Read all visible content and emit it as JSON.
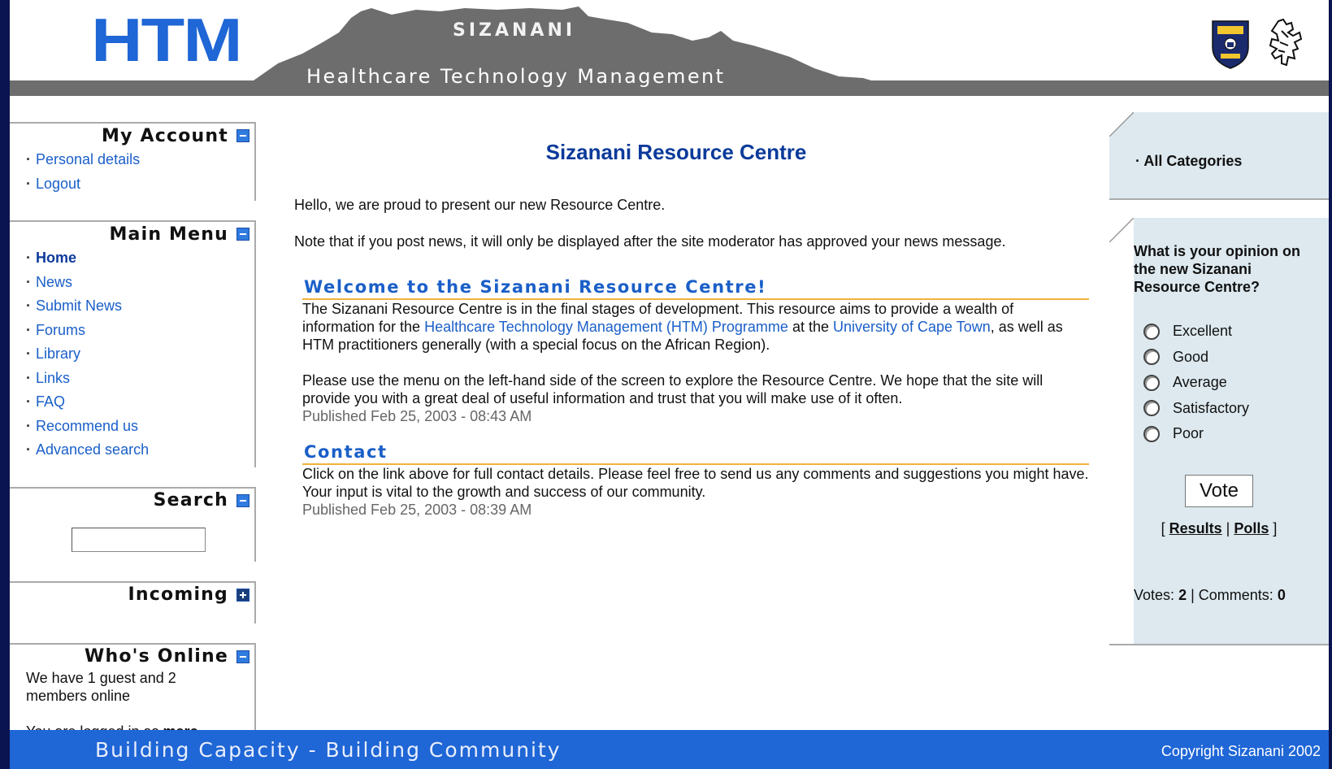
{
  "header": {
    "logo_text": "HTM",
    "site_name": "SIZANANI",
    "subtitle": "Healthcare Technology Management"
  },
  "left": {
    "my_account": {
      "title": "My Account",
      "items": [
        "Personal details",
        "Logout"
      ]
    },
    "main_menu": {
      "title": "Main Menu",
      "items": [
        "Home",
        "News",
        "Submit News",
        "Forums",
        "Library",
        "Links",
        "FAQ",
        "Recommend us",
        "Advanced search"
      ],
      "active": "Home"
    },
    "search": {
      "title": "Search",
      "value": ""
    },
    "incoming": {
      "title": "Incoming"
    },
    "whos_online": {
      "title": "Who's Online",
      "line1": "We have 1 guest and 2 members online",
      "line2_prefix": "You are logged in as ",
      "user": "marc",
      "line2_suffix": "."
    }
  },
  "center": {
    "title": "Sizanani Resource Centre",
    "intro1": "Hello, we are proud to present our new Resource Centre.",
    "intro2": "Note that if you post news, it will only be displayed after the site moderator has approved your news message.",
    "articles": [
      {
        "title": "Welcome to the Sizanani Resource Centre!",
        "p1_a": "The Sizanani Resource Centre is in the final stages of development. This resource aims to provide a wealth of information for the ",
        "link1": "Healthcare Technology Management (HTM) Programme",
        "p1_b": " at the ",
        "link2": "University of Cape Town",
        "p1_c": ", as well as HTM practitioners generally (with a special focus on the African Region).",
        "p2": "Please use the menu on the left-hand side of the screen to explore the Resource Centre. We hope that the site will provide you with a great deal of useful information and trust that you will make use of it often.",
        "published": "Published Feb 25, 2003 - 08:43 AM"
      },
      {
        "title": "Contact",
        "p1": "Click on the link above for full contact details. Please feel free to send us any comments and suggestions you might have. Your input is vital to the growth and success of our community.",
        "published": "Published Feb 25, 2003 - 08:39 AM"
      }
    ]
  },
  "right": {
    "categories": "All Categories",
    "poll": {
      "question": "What is your opinion on the new Sizanani Resource Centre?",
      "options": [
        "Excellent",
        "Good",
        "Average",
        "Satisfactory",
        "Poor"
      ],
      "vote_label": "Vote",
      "results_label": "Results",
      "polls_label": "Polls",
      "votes_label": "Votes:",
      "votes": "2",
      "comments_label": "Comments:",
      "comments": "0"
    }
  },
  "footer": {
    "slogan": "Building Capacity - Building Community",
    "copyright": "Copyright Sizanani 2002"
  },
  "colors": {
    "brand_blue": "#1f66d6",
    "frame_navy": "#0a1450",
    "header_gray": "#6d6d6d",
    "link": "#1a5fc8",
    "accent_rule": "#f2b23a",
    "panel_bg": "#dde9ef"
  }
}
